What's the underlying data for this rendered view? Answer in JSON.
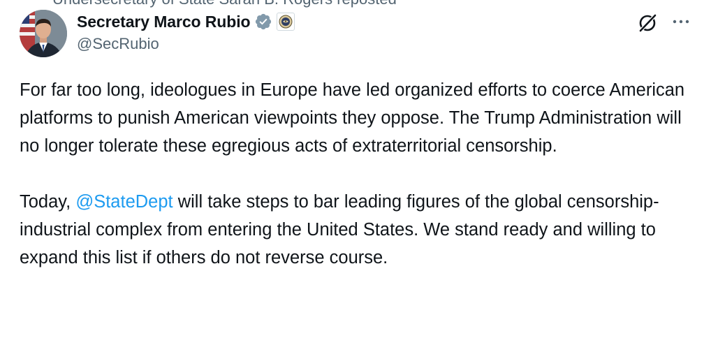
{
  "tweet": {
    "display_name": "Secretary Marco Rubio",
    "handle": "@SecRubio",
    "top_cut_text": "Undersecretary of State Sarah B. Rogers reposted",
    "paragraph1": "For far too long, ideologues in Europe have led organized efforts to coerce American platforms to punish American viewpoints they oppose. The Trump Administration will no longer tolerate these egregious acts of extraterritorial censorship.",
    "paragraph2_before": "Today, ",
    "paragraph2_mention": "@StateDept",
    "paragraph2_after": " will take steps to bar leading figures of the global censorship-industrial complex from entering the United States. We stand ready and willing to expand this list if others do not reverse course."
  },
  "icons": {
    "avatar": "profile-photo",
    "verified": "verified-badge-icon",
    "affiliate": "state-department-seal-icon",
    "grok": "grok-icon",
    "more": "more-options-icon"
  },
  "colors": {
    "text": "#0f1419",
    "secondary": "#536471",
    "link": "#1d9bf0",
    "verified_badge": "#829aab"
  }
}
